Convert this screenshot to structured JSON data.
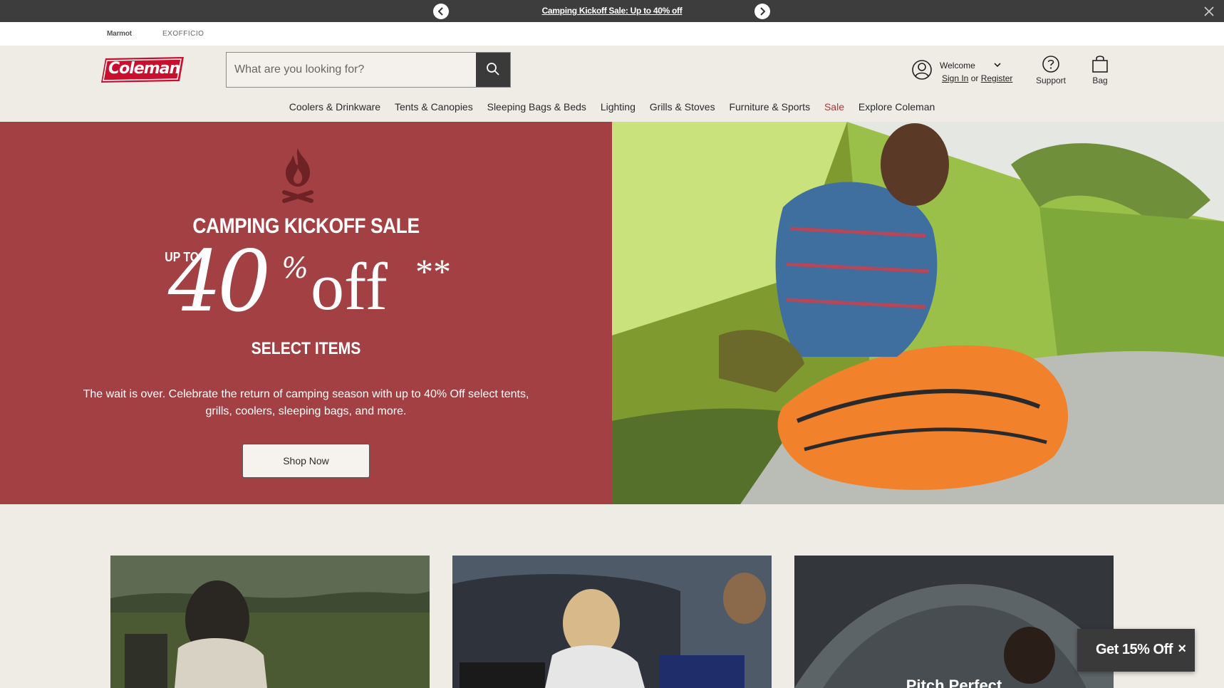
{
  "promo_bar": {
    "text": "Camping Kickoff Sale: Up to 40% off"
  },
  "brand_row": {
    "brands": [
      "Marmot",
      "EXOFFICIO"
    ]
  },
  "header": {
    "logo_text": "Coleman",
    "search": {
      "placeholder": "What are you looking for?",
      "value": ""
    },
    "account": {
      "welcome": "Welcome",
      "sign_in": "Sign In",
      "or": "or",
      "register": "Register"
    },
    "support_label": "Support",
    "bag_label": "Bag"
  },
  "nav": {
    "items": [
      "Coolers & Drinkware",
      "Tents & Canopies",
      "Sleeping Bags & Beds",
      "Lighting",
      "Grills & Stoves",
      "Furniture & Sports",
      "Sale",
      "Explore Coleman"
    ]
  },
  "hero": {
    "title": "CAMPING KICKOFF SALE",
    "up_to": "UP TO",
    "amount": "40",
    "percent": "%",
    "off": "off",
    "asterisks": "**",
    "select_items": "SELECT ITEMS",
    "copy": "The wait is over. Celebrate the return of camping season with up to 40% Off select tents, grills, coolers, sleeping bags, and more.",
    "cta": "Shop Now"
  },
  "cards": [
    {
      "title": ""
    },
    {
      "title": ""
    },
    {
      "title": "Pitch Perfect"
    }
  ],
  "discount_popup": {
    "label": "Get 15% Off",
    "close": "×"
  },
  "colors": {
    "promo_bg": "#3d3d3d",
    "hero_red": "#a34044",
    "sale_red": "#a8393d",
    "page_bg": "#efebe5",
    "logo_red": "#c8102e"
  }
}
